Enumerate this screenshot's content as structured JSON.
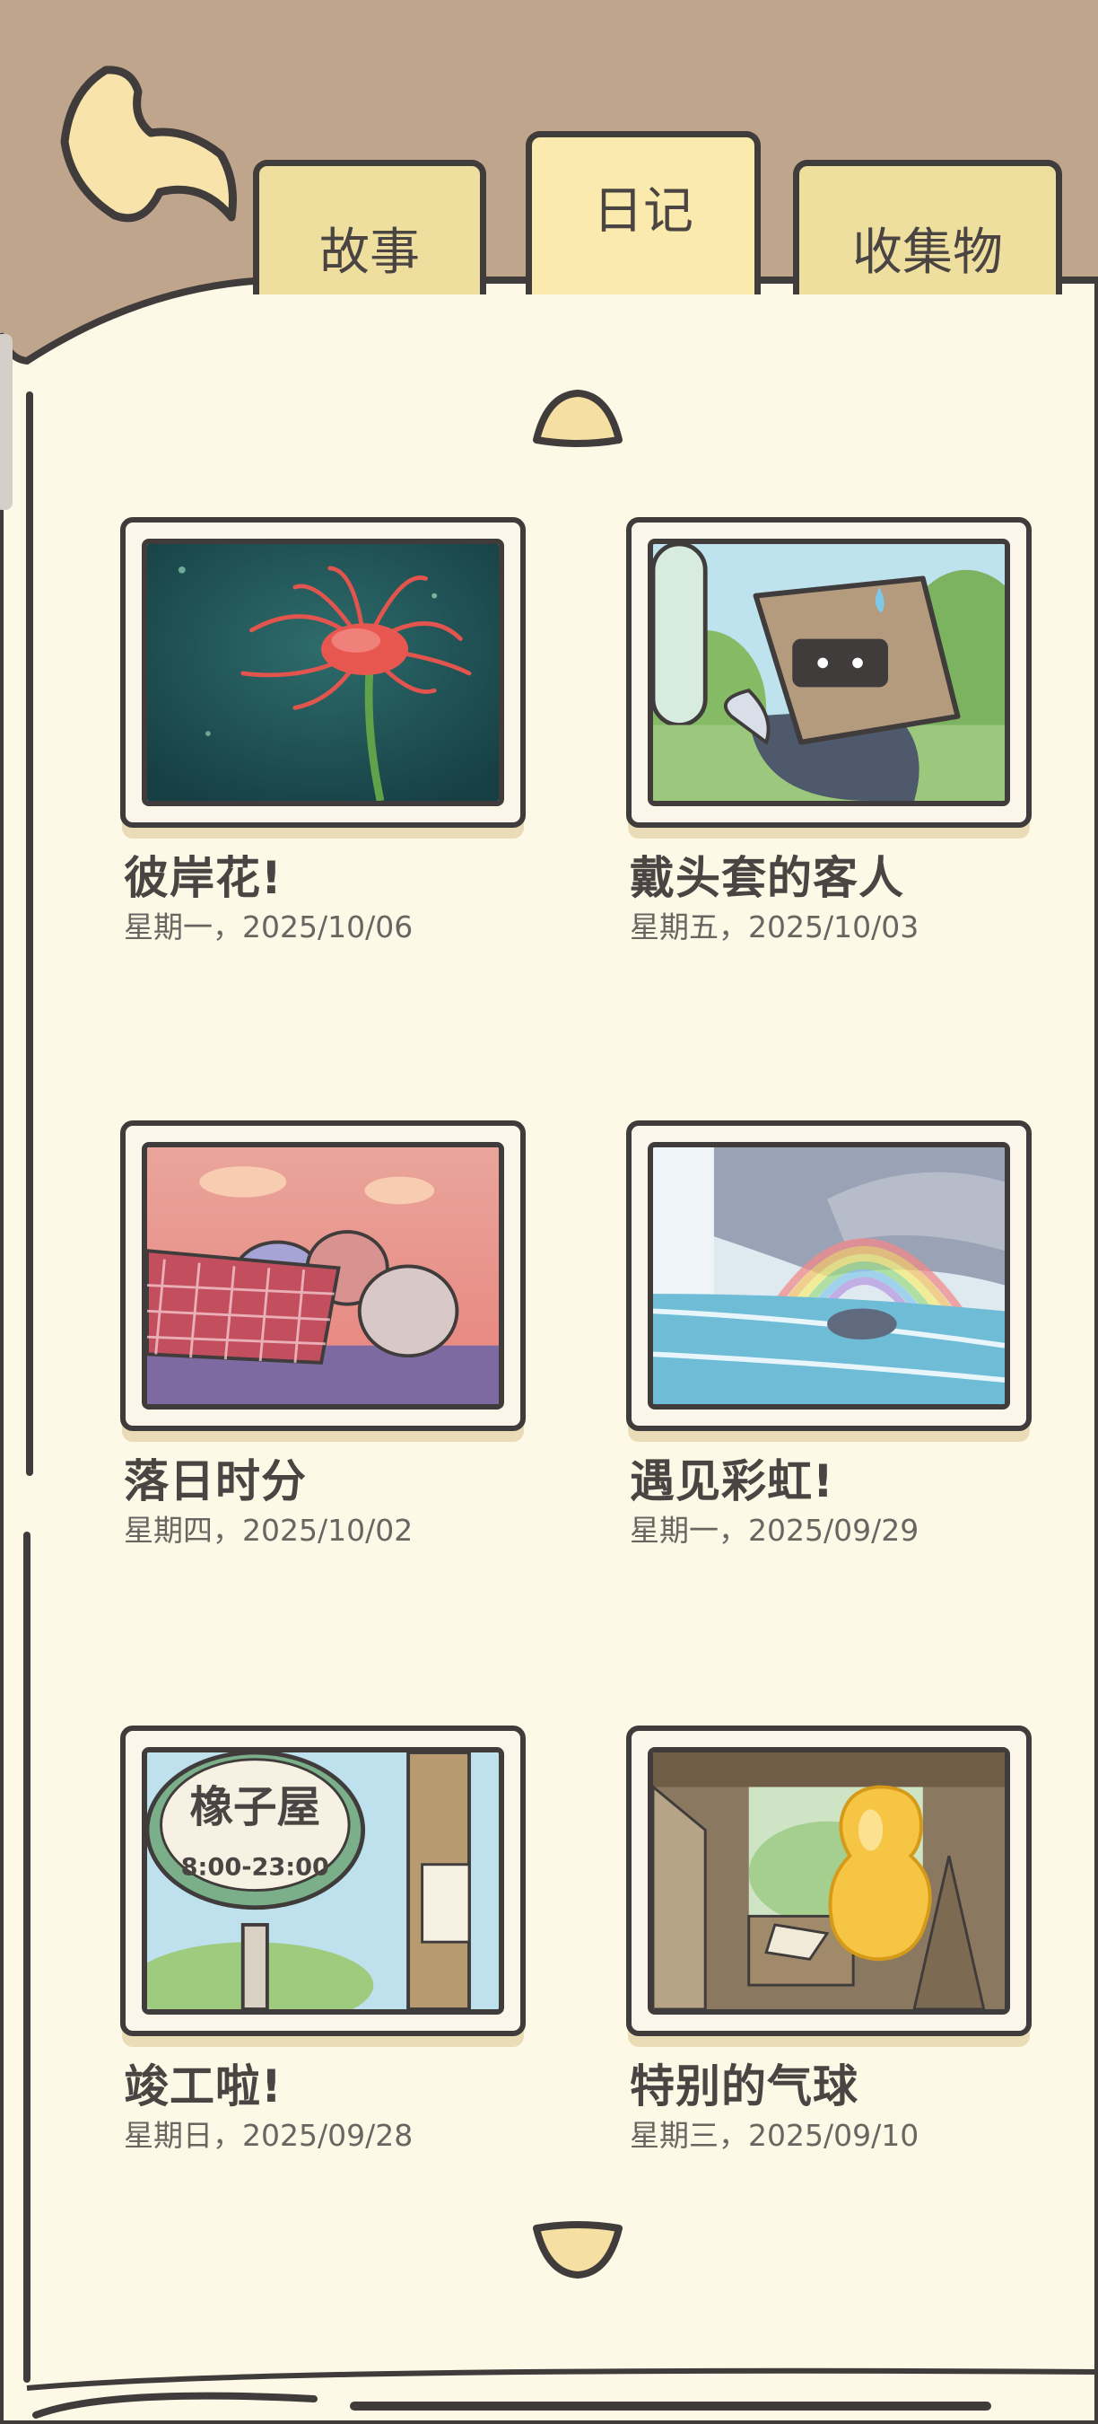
{
  "tabs": {
    "story": "故事",
    "diary": "日记",
    "collection": "收集物"
  },
  "active_tab": "diary",
  "colors": {
    "background": "#c0a58d",
    "panel": "#fdf9e6",
    "tab": "#efdf9f",
    "tab_active": "#fbeaad",
    "outline": "#3f3c3b",
    "arrow": "#f6dfa3"
  },
  "entries": [
    {
      "title": "彼岸花!",
      "date": "星期一，2025/10/06",
      "image": "red-spider-lily"
    },
    {
      "title": "戴头套的客人",
      "date": "星期五，2025/10/03",
      "image": "box-head-guest"
    },
    {
      "title": "落日时分",
      "date": "星期四，2025/10/02",
      "image": "sunset-friends"
    },
    {
      "title": "遇见彩虹!",
      "date": "星期一，2025/09/29",
      "image": "rainbow-waterfall"
    },
    {
      "title": "竣工啦!",
      "date": "星期日，2025/09/28",
      "image": "shop-sign",
      "sign_name": "橡子屋",
      "sign_hours": "8:00-23:00"
    },
    {
      "title": "特别的气球",
      "date": "星期三，2025/09/10",
      "image": "yellow-balloon"
    }
  ]
}
